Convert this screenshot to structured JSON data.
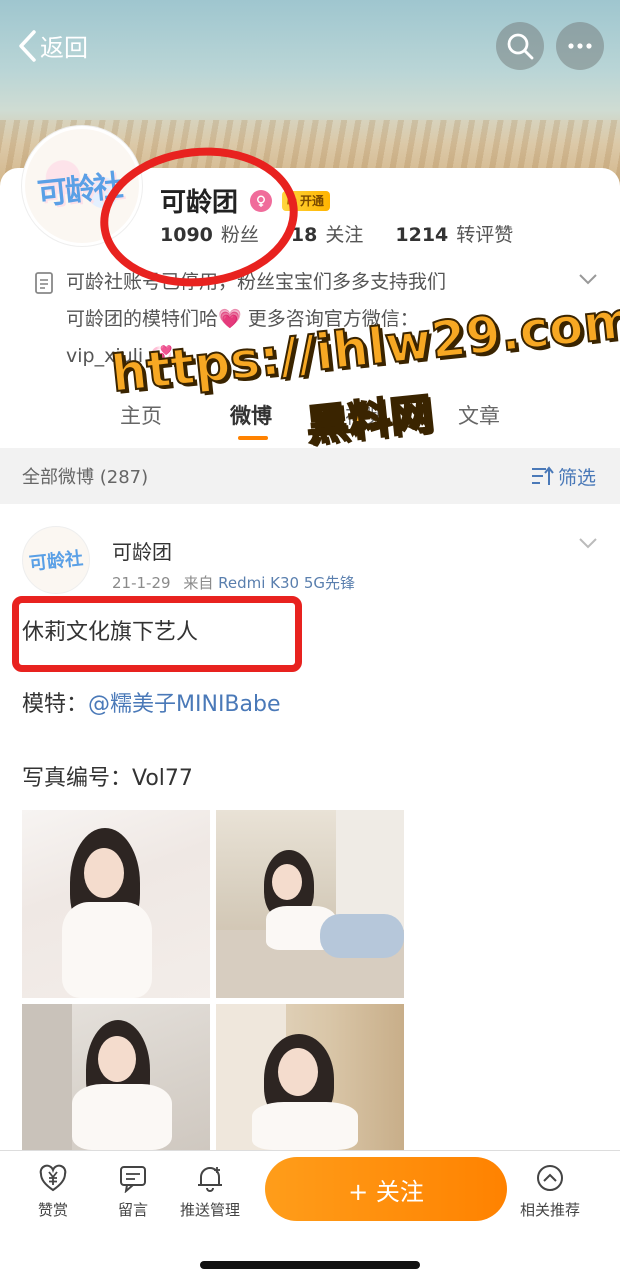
{
  "nav": {
    "back_label": "返回"
  },
  "profile": {
    "avatar_text": "可龄社",
    "name": "可龄团",
    "vip_label": "开通",
    "stats": [
      {
        "num": "1090",
        "label": "粉丝"
      },
      {
        "num": "18",
        "label": "关注"
      },
      {
        "num": "1214",
        "label": "转评赞"
      }
    ],
    "bio_lines": [
      "可龄社账号已停用，粉丝宝宝们多多支持我们",
      "可龄团的模特们哈💗 更多咨询官方微信：",
      "vip_xiuli 💞"
    ]
  },
  "tabs": [
    "主页",
    "微博",
    "视频",
    "文章"
  ],
  "filter_bar": {
    "all_label": "全部微博 (287)",
    "filter_label": "筛选"
  },
  "post": {
    "author": "可龄团",
    "avatar_text": "可龄社",
    "date": "21-1-29",
    "source_prefix": "来自",
    "source": "Redmi K30 5G先锋",
    "line1": "休莉文化旗下艺人",
    "line2_prefix": "模特：",
    "line2_mention": "@糯美子MINIBabe",
    "line3": "写真编号：Vol77"
  },
  "watermark": {
    "url": "https://ihlw29.com",
    "site": "黑料网"
  },
  "bottom_bar": {
    "items": [
      {
        "label": "赞赏",
        "icon": "yen-coin-icon"
      },
      {
        "label": "留言",
        "icon": "message-icon"
      },
      {
        "label": "推送管理",
        "icon": "bell-icon"
      },
      {
        "label": "相关推荐",
        "icon": "chevron-up-circle-icon"
      }
    ],
    "follow_label": "+ 关注"
  },
  "colors": {
    "accent": "#ff8200",
    "link": "#4a79b8",
    "annotation": "#e8221f"
  }
}
